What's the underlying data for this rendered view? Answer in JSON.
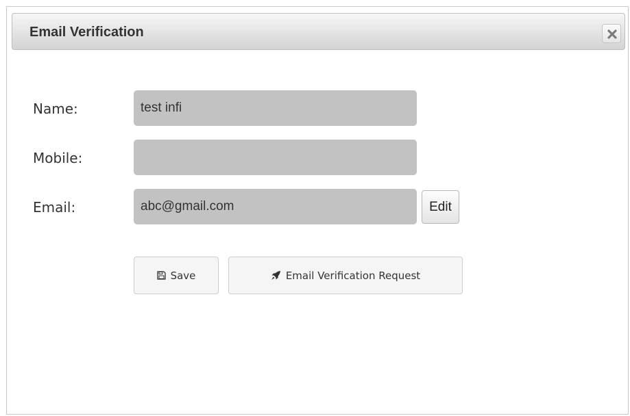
{
  "dialog": {
    "title": "Email Verification",
    "close_icon": "close-icon"
  },
  "form": {
    "name_label": "Name:",
    "name_value": "test infi",
    "mobile_label": "Mobile:",
    "mobile_value": "",
    "email_label": "Email:",
    "email_value": "abc@gmail.com",
    "edit_label": "Edit"
  },
  "actions": {
    "save_label": "Save",
    "save_icon": "floppy-disk-icon",
    "verify_label": "Email Verification Request",
    "verify_icon": "rocket-icon"
  },
  "colors": {
    "field_bg": "#c2c2c2",
    "titlebar_bg": "#e3e3e3"
  }
}
